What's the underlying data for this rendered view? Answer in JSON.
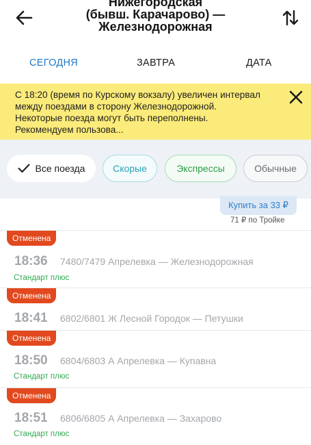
{
  "header": {
    "title": "Нижегородская\n(бывш. Карачарово) —\nЖелезнодорожная"
  },
  "tabs": [
    {
      "label": "СЕГОДНЯ",
      "active": true
    },
    {
      "label": "ЗАВТРА",
      "active": false
    },
    {
      "label": "ДАТА",
      "active": false
    }
  ],
  "banner": {
    "text": "С 18:20 (время по Курскому вокзалу) увеличен интервал между поездами в сторону Железнодорожной. Некоторые поезда могут быть переполнены. Рекомендуем пользова..."
  },
  "filters": [
    {
      "label": "Все поезда",
      "selected": true
    },
    {
      "label": "Скорые",
      "selected": false
    },
    {
      "label": "Экспрессы",
      "selected": false
    },
    {
      "label": "Обычные",
      "selected": false
    }
  ],
  "prev_train": {
    "buy_label": "Купить за 33 ₽",
    "troika_price": "71 ₽ по Тройке"
  },
  "trains": [
    {
      "status": "Отменена",
      "time": "18:36",
      "route": "7480/7479 Апрелевка — Железнодорожная",
      "type": "Стандарт плюс"
    },
    {
      "status": "Отменена",
      "time": "18:41",
      "route": "6802/6801 Ж Лесной Городок — Петушки",
      "type": ""
    },
    {
      "status": "Отменена",
      "time": "18:50",
      "route": "6804/6803 А Апрелевка — Купавна",
      "type": "Стандарт плюс"
    },
    {
      "status": "Отменена",
      "time": "18:51",
      "route": "6806/6805 А Апрелевка — Захарово",
      "type": "Стандарт плюс"
    }
  ],
  "colors": {
    "accent": "#1e78c6",
    "banner_bg": "#fbeb7a",
    "cancelled_badge": "#e2491e",
    "fast": "#2ba0b6",
    "express": "#2d9c48"
  }
}
